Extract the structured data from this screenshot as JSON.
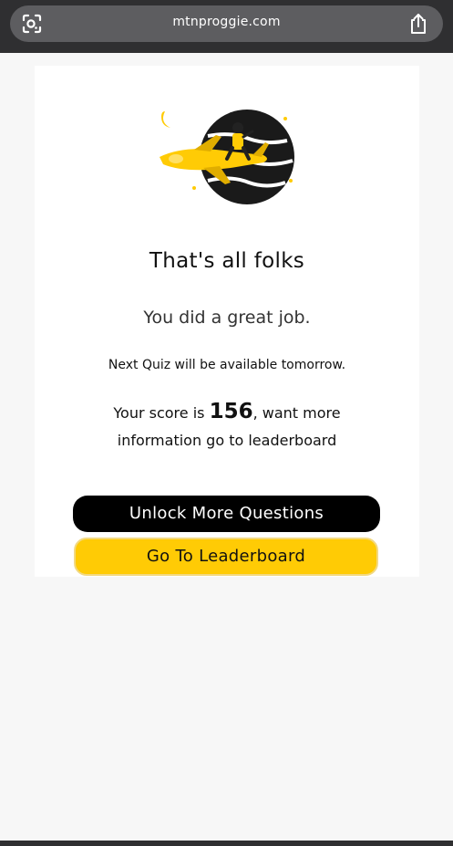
{
  "browser": {
    "url": "mtnproggie.com",
    "left_icon": "lens-icon",
    "right_icon": "share-icon"
  },
  "result": {
    "illustration": "rocket-rider-icon",
    "title": "That's all folks",
    "subtitle": "You did a great job.",
    "next_quiz": "Next Quiz will be available tomorrow.",
    "score_prefix": "Your score is ",
    "score": "156",
    "score_suffix": ", want more",
    "score_line2": "information go to leaderboard"
  },
  "buttons": {
    "unlock": "Unlock More Questions",
    "leaderboard": "Go To Leaderboard"
  },
  "colors": {
    "accent": "#ffcb05",
    "dark": "#000000",
    "browser_bar": "#2f2f31"
  }
}
